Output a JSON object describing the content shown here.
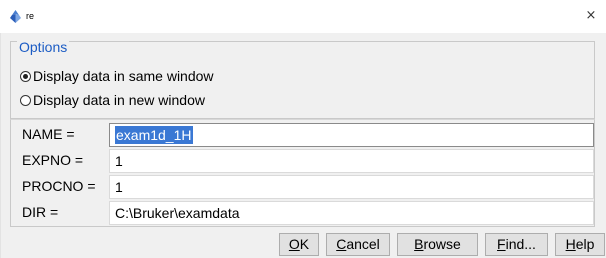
{
  "window": {
    "title": "re",
    "close_glyph": "×",
    "app_icon": "bruker-topspin-icon"
  },
  "options": {
    "legend": "Options",
    "radios": [
      {
        "label": "Display data in same window",
        "checked": true
      },
      {
        "label": "Display data in new window",
        "checked": false
      }
    ]
  },
  "fields": {
    "name": {
      "label": "NAME =",
      "value": "exam1d_1H"
    },
    "expno": {
      "label": "EXPNO =",
      "value": "1"
    },
    "procno": {
      "label": "PROCNO =",
      "value": "1"
    },
    "dir": {
      "label": "DIR =",
      "value": "C:\\Bruker\\examdata"
    }
  },
  "buttons": {
    "ok": {
      "mnemonic": "O",
      "rest": "K"
    },
    "cancel": {
      "mnemonic": "C",
      "rest": "ancel"
    },
    "browse": {
      "mnemonic": "B",
      "rest": "rowse"
    },
    "find": {
      "mnemonic": "F",
      "rest": "ind..."
    },
    "help": {
      "mnemonic": "H",
      "rest": "elp"
    }
  },
  "colors": {
    "accent": "#1c5cc4",
    "selection": "#3a78d4"
  }
}
